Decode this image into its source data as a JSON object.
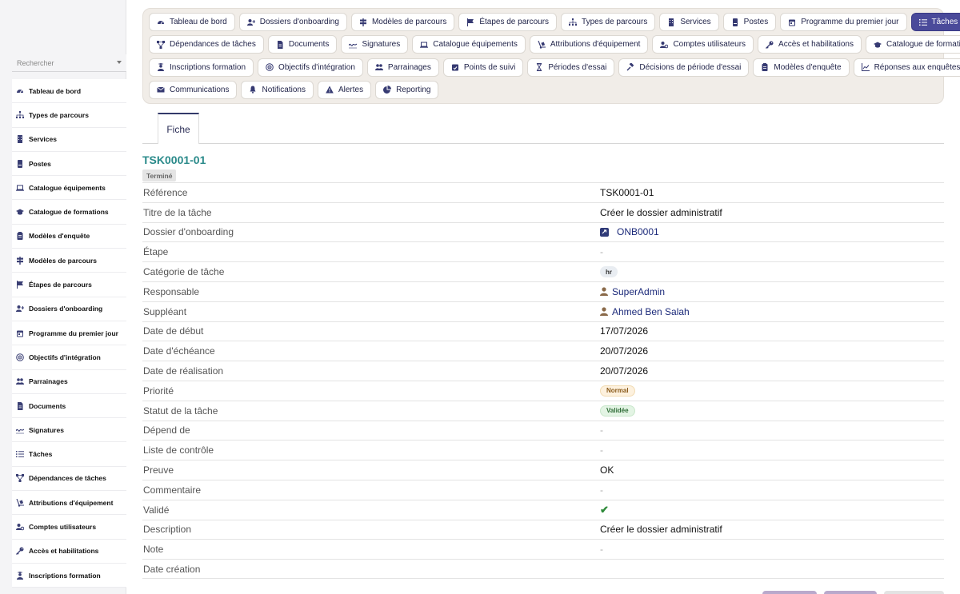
{
  "sidebar": {
    "search_placeholder": "Rechercher",
    "items": [
      {
        "label": "Tableau de bord",
        "icon": "dashboard-icon"
      },
      {
        "label": "Types de parcours",
        "icon": "sitemap-icon"
      },
      {
        "label": "Services",
        "icon": "building-icon"
      },
      {
        "label": "Postes",
        "icon": "id-badge-icon"
      },
      {
        "label": "Catalogue équipements",
        "icon": "laptop-icon"
      },
      {
        "label": "Catalogue de formations",
        "icon": "graduation-cap-icon"
      },
      {
        "label": "Modèles d'enquête",
        "icon": "clipboard-icon"
      },
      {
        "label": "Modèles de parcours",
        "icon": "signpost-icon"
      },
      {
        "label": "Étapes de parcours",
        "icon": "flag-icon"
      },
      {
        "label": "Dossiers d'onboarding",
        "icon": "user-plus-icon"
      },
      {
        "label": "Programme du premier jour",
        "icon": "calendar-icon"
      },
      {
        "label": "Objectifs d'intégration",
        "icon": "target-icon"
      },
      {
        "label": "Parrainages",
        "icon": "users-icon"
      },
      {
        "label": "Documents",
        "icon": "file-icon"
      },
      {
        "label": "Signatures",
        "icon": "signature-icon"
      },
      {
        "label": "Tâches",
        "icon": "tasks-icon"
      },
      {
        "label": "Dépendances de tâches",
        "icon": "diagram-icon"
      },
      {
        "label": "Attributions d'équipement",
        "icon": "dolly-icon"
      },
      {
        "label": "Comptes utilisateurs",
        "icon": "user-gear-icon"
      },
      {
        "label": "Accès et habilitations",
        "icon": "key-icon"
      },
      {
        "label": "Inscriptions formation",
        "icon": "user-graduate-icon"
      }
    ]
  },
  "tabs": {
    "rows": [
      [
        {
          "label": "Tableau de bord",
          "icon": "dashboard-icon"
        },
        {
          "label": "Dossiers d'onboarding",
          "icon": "user-plus-icon"
        },
        {
          "label": "Modèles de parcours",
          "icon": "signpost-icon"
        },
        {
          "label": "Étapes de parcours",
          "icon": "flag-icon"
        },
        {
          "label": "Types de parcours",
          "icon": "sitemap-icon"
        },
        {
          "label": "Services",
          "icon": "building-icon"
        },
        {
          "label": "Postes",
          "icon": "id-badge-icon"
        },
        {
          "label": "Programme du premier jour",
          "icon": "calendar-icon"
        },
        {
          "label": "Tâches",
          "icon": "tasks-icon",
          "active": true
        }
      ],
      [
        {
          "label": "Dépendances de tâches",
          "icon": "diagram-icon"
        },
        {
          "label": "Documents",
          "icon": "file-icon"
        },
        {
          "label": "Signatures",
          "icon": "signature-icon"
        },
        {
          "label": "Catalogue équipements",
          "icon": "laptop-icon"
        },
        {
          "label": "Attributions d'équipement",
          "icon": "dolly-icon"
        },
        {
          "label": "Comptes utilisateurs",
          "icon": "user-gear-icon"
        },
        {
          "label": "Accès et habilitations",
          "icon": "key-icon"
        },
        {
          "label": "Catalogue de formations",
          "icon": "graduation-cap-icon"
        }
      ],
      [
        {
          "label": "Inscriptions formation",
          "icon": "user-graduate-icon"
        },
        {
          "label": "Objectifs d'intégration",
          "icon": "target-icon"
        },
        {
          "label": "Parrainages",
          "icon": "users-icon"
        },
        {
          "label": "Points de suivi",
          "icon": "calendar-check-icon"
        },
        {
          "label": "Périodes d'essai",
          "icon": "hourglass-icon"
        },
        {
          "label": "Décisions de période d'essai",
          "icon": "gavel-icon"
        },
        {
          "label": "Modèles d'enquête",
          "icon": "clipboard-icon"
        },
        {
          "label": "Réponses aux enquêtes",
          "icon": "chart-icon"
        }
      ],
      [
        {
          "label": "Communications",
          "icon": "envelope-icon"
        },
        {
          "label": "Notifications",
          "icon": "bell-icon"
        },
        {
          "label": "Alertes",
          "icon": "warning-icon"
        },
        {
          "label": "Reporting",
          "icon": "pie-chart-icon"
        }
      ]
    ]
  },
  "subtab": {
    "label": "Fiche"
  },
  "record": {
    "title": "TSK0001-01",
    "status": "Terminé",
    "fields": {
      "reference": {
        "label": "Référence",
        "value": "TSK0001-01"
      },
      "titre": {
        "label": "Titre de la tâche",
        "value": "Créer le dossier administratif"
      },
      "dossier": {
        "label": "Dossier d'onboarding",
        "value": "ONB0001"
      },
      "etape": {
        "label": "Étape",
        "value": "-"
      },
      "categorie": {
        "label": "Catégorie de tâche",
        "value": "hr"
      },
      "responsable": {
        "label": "Responsable",
        "value": "SuperAdmin"
      },
      "suppleant": {
        "label": "Suppléant",
        "value": "Ahmed Ben Salah"
      },
      "date_debut": {
        "label": "Date de début",
        "value": "17/07/2026"
      },
      "date_echeance": {
        "label": "Date d'échéance",
        "value": "20/07/2026"
      },
      "date_realisation": {
        "label": "Date de réalisation",
        "value": "20/07/2026"
      },
      "priorite": {
        "label": "Priorité",
        "value": "Normal"
      },
      "statut": {
        "label": "Statut de la tâche",
        "value": "Validée"
      },
      "depend_de": {
        "label": "Dépend de",
        "value": "-"
      },
      "liste_controle": {
        "label": "Liste de contrôle",
        "value": "-"
      },
      "preuve": {
        "label": "Preuve",
        "value": "OK"
      },
      "commentaire": {
        "label": "Commentaire",
        "value": "-"
      },
      "valide": {
        "label": "Validé",
        "value": "✔"
      },
      "description": {
        "label": "Description",
        "value": "Créer le dossier administratif"
      },
      "note": {
        "label": "Note",
        "value": "-"
      },
      "date_creation": {
        "label": "Date création",
        "value": ""
      }
    }
  },
  "colors": {
    "accent": "#4a4a9a",
    "title": "#2a8a8a",
    "link": "#1c2a7a",
    "panel": "#f1ede8"
  }
}
